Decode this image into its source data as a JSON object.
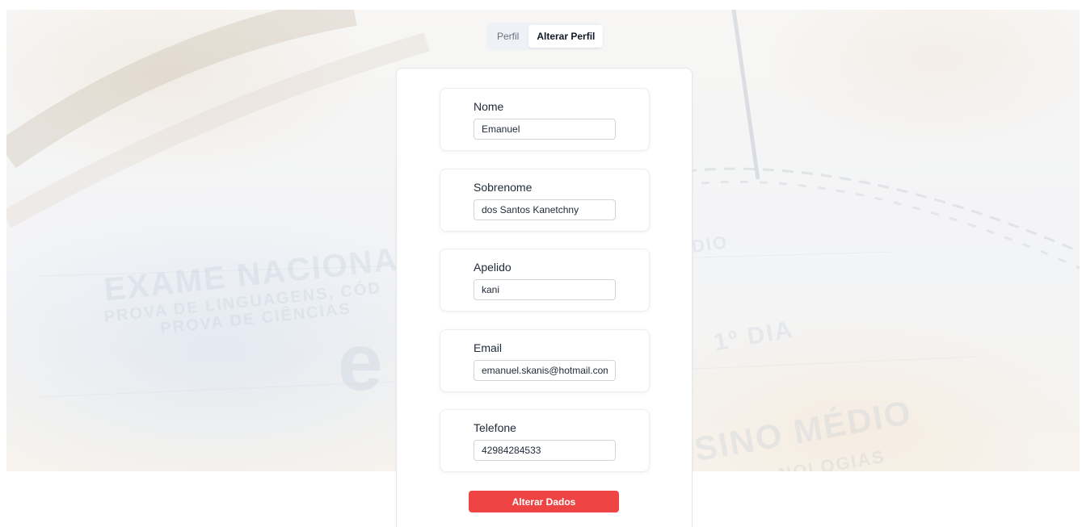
{
  "tabs": [
    {
      "label": "Perfil",
      "active": false
    },
    {
      "label": "Alterar Perfil",
      "active": true
    }
  ],
  "form": {
    "fields": [
      {
        "label": "Nome",
        "value": "Emanuel"
      },
      {
        "label": "Sobrenome",
        "value": "dos Santos Kanetchny"
      },
      {
        "label": "Apelido",
        "value": "kani"
      },
      {
        "label": "Email",
        "value": "emanuel.skanis@hotmail.com"
      },
      {
        "label": "Telefone",
        "value": "42984284533"
      }
    ],
    "submit_label": "Alterar Dados"
  },
  "background": {
    "texts": [
      "EXAME NACIONAL",
      "PROVA DE LINGUAGENS, CÓD",
      "PROVA DE CIÊNCIAS",
      "1º DIA",
      "SINO MÉDIO",
      "NOLOGIAS",
      "DIO",
      "e"
    ]
  },
  "colors": {
    "accent": "#ef4444",
    "tab_bg": "#eef1f5",
    "card_border": "#e5e7eb"
  }
}
